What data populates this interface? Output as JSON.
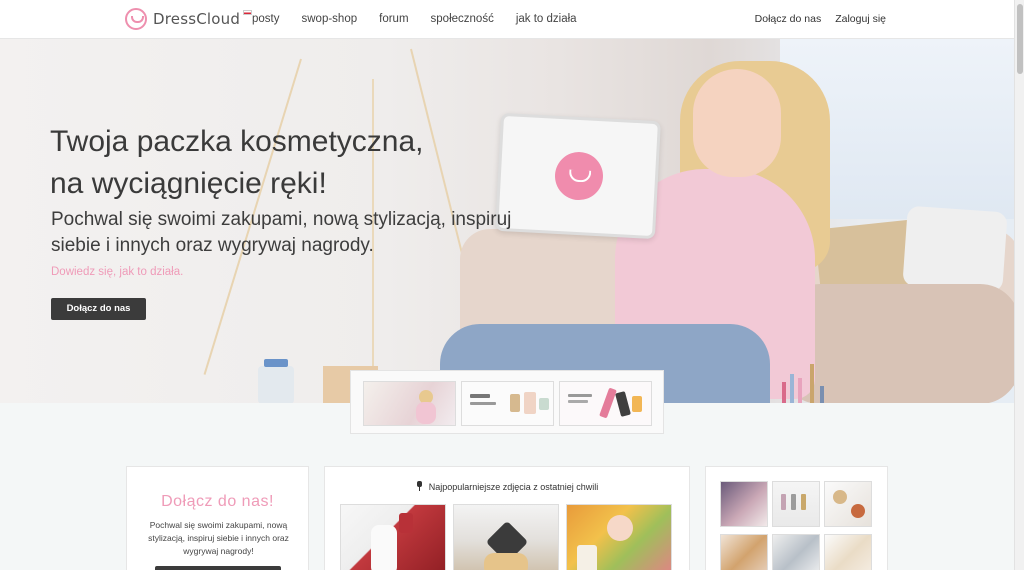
{
  "header": {
    "logo_text": "DressCloud",
    "nav": [
      "posty",
      "swop-shop",
      "forum",
      "społeczność",
      "jak to działa"
    ],
    "join_label": "Dołącz do nas",
    "login_label": "Zaloguj się"
  },
  "hero": {
    "title_line1": "Twoja paczka kosmetyczna,",
    "title_line2": "na wyciągnięcie ręki!",
    "subtitle": "Pochwal się swoimi zakupami, nową stylizacją, inspiruj siebie i innych oraz wygrywaj nagrody.",
    "link": "Dowiedz się, jak to działa.",
    "button": "Dołącz do nas"
  },
  "join_card": {
    "title": "Dołącz do nas!",
    "text": "Pochwal się swoimi zakupami, nową stylizacją, inspiruj siebie i innych oraz wygrywaj nagrody!"
  },
  "popular": {
    "heading": "Najpopularniejsze zdjęcia z ostatniej chwili"
  },
  "colors": {
    "accent_pink": "#ef9bb8",
    "button_dark": "#3b3b3b"
  }
}
